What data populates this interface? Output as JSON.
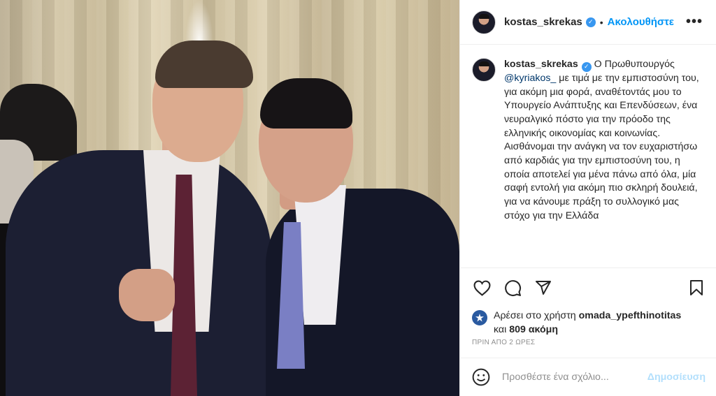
{
  "post": {
    "username": "kostas_skrekas",
    "follow_label": "Ακολουθήστε",
    "dot": "•",
    "more_label": "•••",
    "caption": {
      "username": "kostas_skrekas",
      "part1": " Ο Πρωθυπουργός ",
      "mention": "@kyriakos_",
      "part2": " με τιμά με την εμπιστοσύνη του, για ακόμη μια φορά, αναθέτοντάς μου το Υπουργείο Ανάπτυξης και Επενδύσεων, ένα νευραλγικό πόστο για την πρόοδο της ελληνικής οικονομίας και κοινωνίας.",
      "part3": "Αισθάνομαι την ανάγκη να τον ευχαριστήσω από καρδιάς για την εμπιστοσύνη του, η οποία αποτελεί για μένα πάνω από όλα, μία σαφή εντολή για ακόμη πιο σκληρή δουλειά, για να κάνουμε πράξη το συλλογικό μας στόχο για την Ελλάδα"
    },
    "likes": {
      "prefix": "Αρέσει στο χρήστη ",
      "user": "omada_ypefthinotitas",
      "and": "και ",
      "count": "809 ακόμη"
    },
    "timestamp": "ΠΡΙΝ ΑΠΟ 2 ΩΡΕΣ",
    "comment_placeholder": "Προσθέστε ένα σχόλιο...",
    "post_button": "Δημοσίευση",
    "colors": {
      "link": "#0095f6",
      "mention": "#00376b",
      "verified": "#3897f0",
      "post_disabled": "#b2dffc"
    },
    "icons": [
      "heart-icon",
      "comment-icon",
      "share-icon",
      "bookmark-icon",
      "emoji-icon",
      "verified-icon"
    ]
  }
}
